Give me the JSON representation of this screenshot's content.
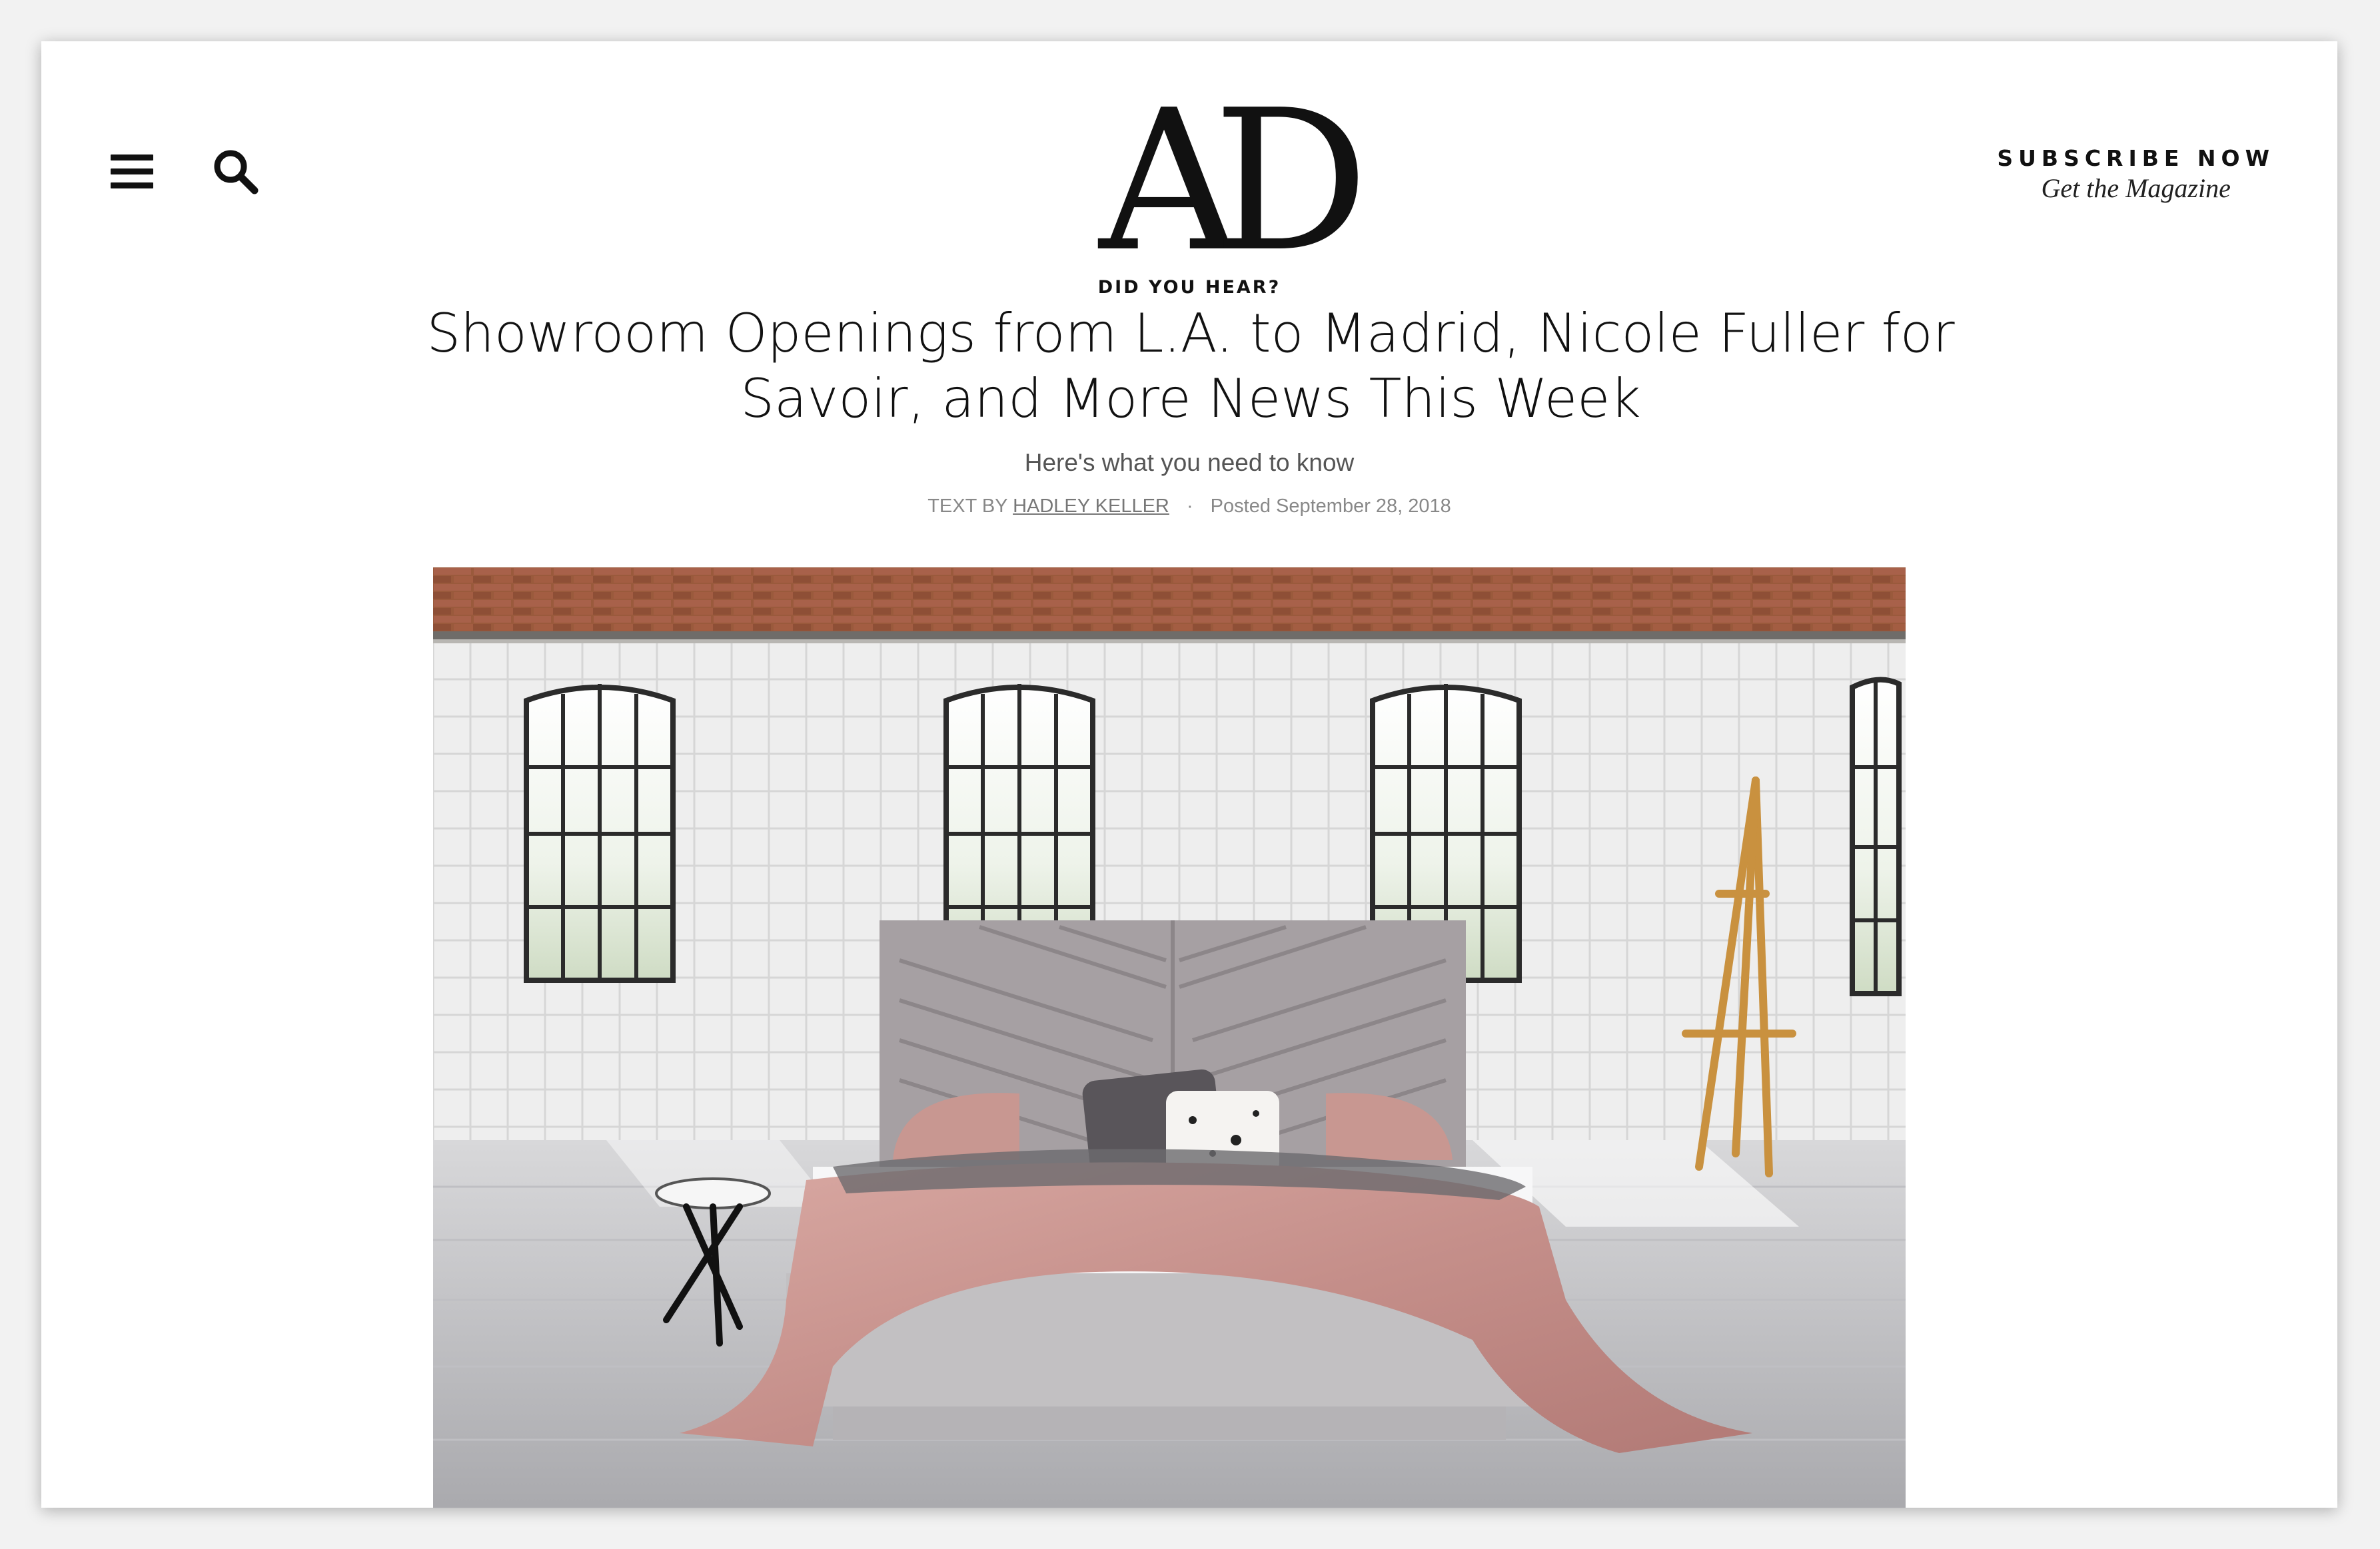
{
  "header": {
    "logo": "AD",
    "subscribe_label": "SUBSCRIBE NOW",
    "subscribe_sub": "Get the Magazine"
  },
  "icons": {
    "menu": "hamburger-menu-icon",
    "search": "search-icon"
  },
  "article": {
    "rubric": "DID YOU HEAR?",
    "headline": "Showroom Openings from L.A. to Madrid, Nicole Fuller for Savoir, and More News This Week",
    "dek": "Here's what you need to know",
    "byline_prefix": "TEXT BY",
    "author": "HADLEY KELLER",
    "separator": "·",
    "posted": "Posted September 28, 2018"
  },
  "hero": {
    "description": "photo"
  },
  "colors": {
    "text": "#111111",
    "background": "#ffffff",
    "muted": "#888888"
  }
}
